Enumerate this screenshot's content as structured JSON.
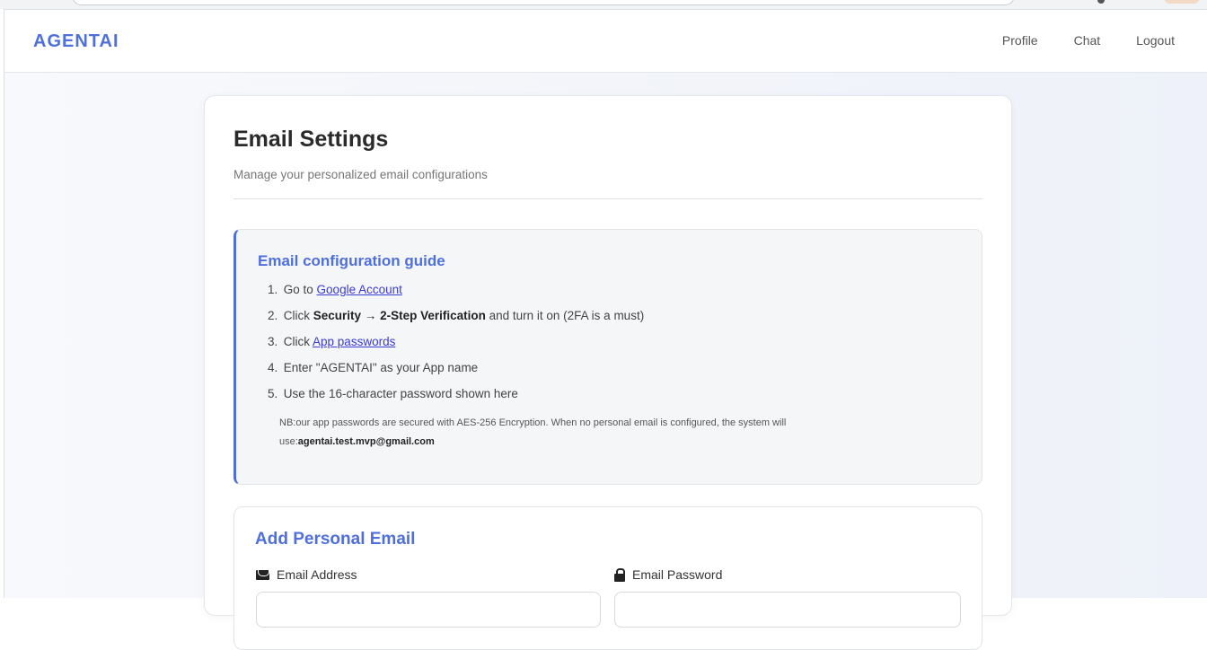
{
  "brand": "AGENTAI",
  "nav": {
    "profile": "Profile",
    "chat": "Chat",
    "logout": "Logout"
  },
  "settings": {
    "title": "Email Settings",
    "subtitle": "Manage your personalized email configurations"
  },
  "guide": {
    "title": "Email configuration guide",
    "steps": [
      {
        "num": "1.",
        "pre": "Go to ",
        "link": "Google Account"
      },
      {
        "num": "2.",
        "pre": "Click ",
        "b1": "Security",
        "arrow": " → ",
        "b2": "2-Step Verification",
        "post": " and turn it on (2FA is a must)"
      },
      {
        "num": "3.",
        "pre": "Click ",
        "link": "App passwords"
      },
      {
        "num": "4.",
        "text": "Enter \"AGENTAI\" as your App name"
      },
      {
        "num": "5.",
        "text": "Use the 16-character password shown here"
      }
    ],
    "note_line1": "NB:our app passwords are secured with AES-256 Encryption. When no personal email is configured, the system will",
    "note_prefix": "use:",
    "note_email": "agentai.test.mvp@gmail.com"
  },
  "add_email": {
    "title": "Add Personal Email",
    "email_label": "Email Address",
    "password_label": "Email Password",
    "email_value": "",
    "password_value": ""
  },
  "colors": {
    "accent": "#4f6fdc",
    "link": "#3a3ad6"
  },
  "icons": {
    "email": "envelope-icon",
    "password": "lock-icon"
  }
}
